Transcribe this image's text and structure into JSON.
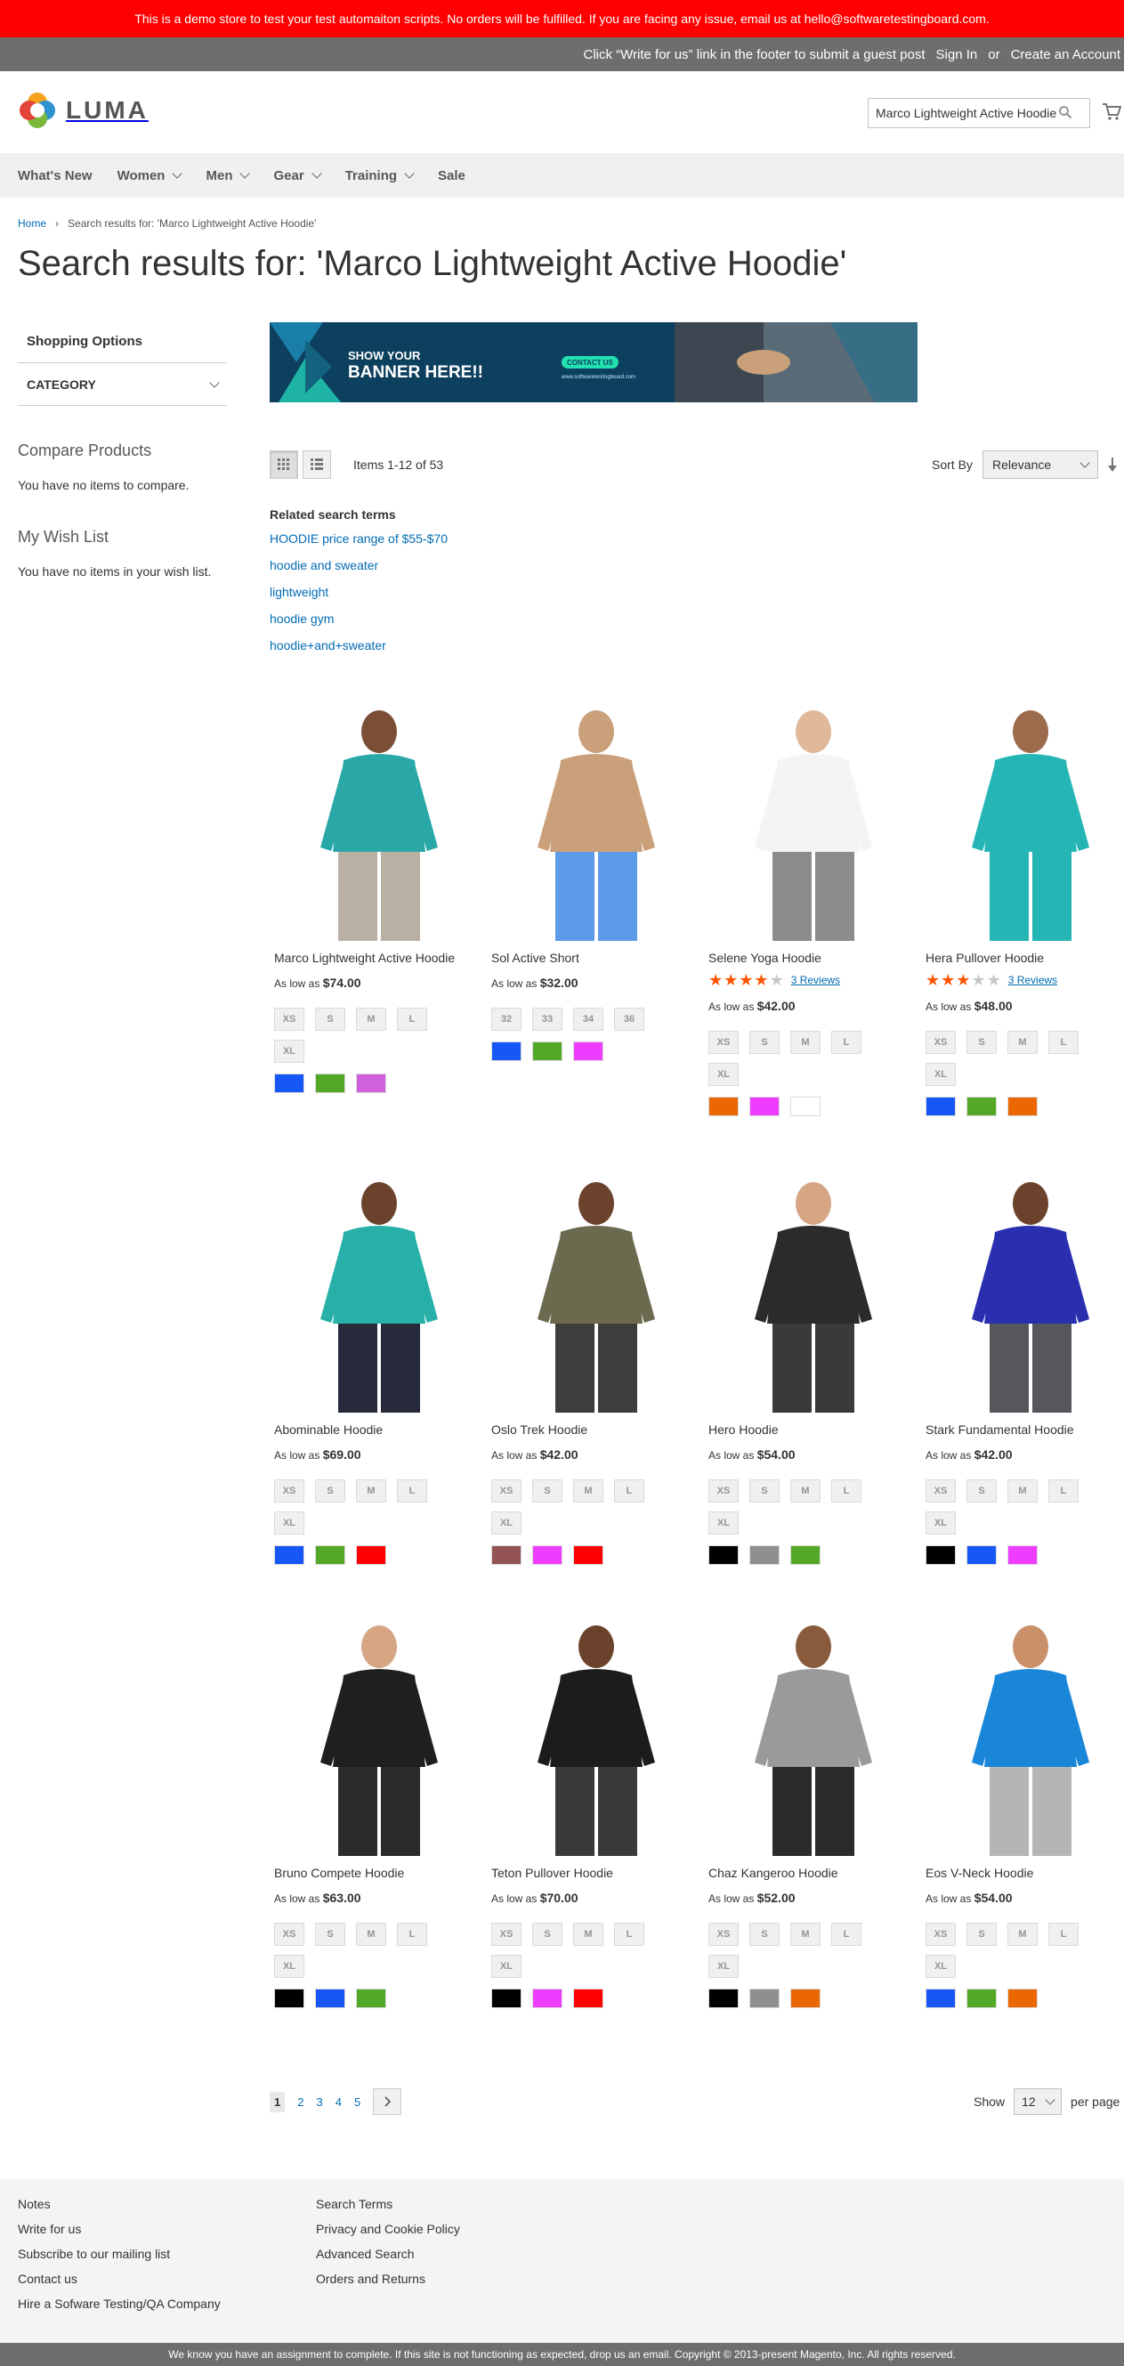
{
  "demo_notice": "This is a demo store to test your test automaiton scripts. No orders will be fulfilled. If you are facing any issue, email us at hello@softwaretestingboard.com.",
  "panel": {
    "guest_post": "Click “Write for us” link in the footer to submit a guest post",
    "sign_in": "Sign In",
    "or": "or",
    "create_account": "Create an Account"
  },
  "header": {
    "logo": "LUMA",
    "search_value": "Marco Lightweight Active Hoodie"
  },
  "nav": {
    "whats_new": "What's New",
    "women": "Women",
    "men": "Men",
    "gear": "Gear",
    "training": "Training",
    "sale": "Sale"
  },
  "breadcrumb": {
    "home": "Home",
    "sep": "›",
    "current": "Search results for: 'Marco Lightweight Active Hoodie'"
  },
  "page_title": "Search results for: 'Marco Lightweight Active Hoodie'",
  "sidebar": {
    "shopping_options": "Shopping Options",
    "category": "Category",
    "compare_title": "Compare Products",
    "compare_text": "You have no items to compare.",
    "wishlist_title": "My Wish List",
    "wishlist_text": "You have no items in your wish list."
  },
  "banner": {
    "line1": "SHOW YOUR",
    "line2": "BANNER HERE!!",
    "cta": "CONTACT US",
    "url": "www.softwaretestingboard.com"
  },
  "toolbar": {
    "amount": "Items 1-12 of 53",
    "sort_by": "Sort By",
    "sort_value": "Relevance"
  },
  "related": {
    "title": "Related search terms",
    "terms": [
      "HOODIE price range of $55-$70",
      "hoodie and sweater",
      "lightweight",
      "hoodie gym",
      "hoodie+and+sweater"
    ]
  },
  "price_prefix": "As low as",
  "products": [
    {
      "name": "Marco Lightweight Active Hoodie",
      "price": "$74.00",
      "sizes": [
        "XS",
        "S",
        "M",
        "L",
        "XL"
      ],
      "colors": [
        "#1857f7",
        "#53a828",
        "#d161db"
      ],
      "shirt": "#2aa8a8",
      "pants": "#b9b0a3",
      "skin": "#7a4f36",
      "reviews": "",
      "rating": 0
    },
    {
      "name": "Sol Active Short",
      "price": "$32.00",
      "sizes": [
        "32",
        "33",
        "34",
        "36"
      ],
      "colors": [
        "#1857f7",
        "#53a828",
        "#ef3dff"
      ],
      "shirt": "#c9a07a",
      "pants": "#5b9be8",
      "skin": "#c9a07a",
      "reviews": "",
      "rating": 0
    },
    {
      "name": "Selene Yoga Hoodie",
      "price": "$42.00",
      "sizes": [
        "XS",
        "S",
        "M",
        "L",
        "XL"
      ],
      "colors": [
        "#eb6703",
        "#ef3dff",
        "#ffffff"
      ],
      "shirt": "#f4f4f4",
      "pants": "#8c8c8c",
      "skin": "#e0b89a",
      "reviews": "3 Reviews",
      "rating": 4
    },
    {
      "name": "Hera Pullover Hoodie",
      "price": "$48.00",
      "sizes": [
        "XS",
        "S",
        "M",
        "L",
        "XL"
      ],
      "colors": [
        "#1857f7",
        "#53a828",
        "#eb6703"
      ],
      "shirt": "#25b5b5",
      "pants": "#25b5b5",
      "skin": "#9c6b4c",
      "reviews": "3 Reviews",
      "rating": 3
    },
    {
      "name": "Abominable Hoodie",
      "price": "$69.00",
      "sizes": [
        "XS",
        "S",
        "M",
        "L",
        "XL"
      ],
      "colors": [
        "#1857f7",
        "#53a828",
        "#ff0000"
      ],
      "shirt": "#26b0a8",
      "pants": "#262a3b",
      "skin": "#6b432d",
      "reviews": "",
      "rating": 0
    },
    {
      "name": "Oslo Trek Hoodie",
      "price": "$42.00",
      "sizes": [
        "XS",
        "S",
        "M",
        "L",
        "XL"
      ],
      "colors": [
        "#945454",
        "#ef3dff",
        "#ff0000"
      ],
      "shirt": "#6b6a4f",
      "pants": "#3d3d3d",
      "skin": "#6b432d",
      "reviews": "",
      "rating": 0
    },
    {
      "name": "Hero Hoodie",
      "price": "$54.00",
      "sizes": [
        "XS",
        "S",
        "M",
        "L",
        "XL"
      ],
      "colors": [
        "#000000",
        "#8f8f8f",
        "#53a828"
      ],
      "shirt": "#2b2b2b",
      "pants": "#3a3a3a",
      "skin": "#d6a584",
      "reviews": "",
      "rating": 0
    },
    {
      "name": "Stark Fundamental Hoodie",
      "price": "$42.00",
      "sizes": [
        "XS",
        "S",
        "M",
        "L",
        "XL"
      ],
      "colors": [
        "#000000",
        "#1857f7",
        "#ef3dff"
      ],
      "shirt": "#2a2fb0",
      "pants": "#55575c",
      "skin": "#6b432d",
      "reviews": "",
      "rating": 0
    },
    {
      "name": "Bruno Compete Hoodie",
      "price": "$63.00",
      "sizes": [
        "XS",
        "S",
        "M",
        "L",
        "XL"
      ],
      "colors": [
        "#000000",
        "#1857f7",
        "#53a828"
      ],
      "shirt": "#1f1f1f",
      "pants": "#2b2b2b",
      "skin": "#d6a584",
      "reviews": "",
      "rating": 0
    },
    {
      "name": "Teton Pullover Hoodie",
      "price": "$70.00",
      "sizes": [
        "XS",
        "S",
        "M",
        "L",
        "XL"
      ],
      "colors": [
        "#000000",
        "#ef3dff",
        "#ff0000"
      ],
      "shirt": "#1c1c1c",
      "pants": "#3a3a3a",
      "skin": "#6b432d",
      "reviews": "",
      "rating": 0
    },
    {
      "name": "Chaz Kangeroo Hoodie",
      "price": "$52.00",
      "sizes": [
        "XS",
        "S",
        "M",
        "L",
        "XL"
      ],
      "colors": [
        "#000000",
        "#8f8f8f",
        "#eb6703"
      ],
      "shirt": "#9a9a9a",
      "pants": "#2b2b2b",
      "skin": "#8a5a3c",
      "reviews": "",
      "rating": 0
    },
    {
      "name": "Eos V-Neck Hoodie",
      "price": "$54.00",
      "sizes": [
        "XS",
        "S",
        "M",
        "L",
        "XL"
      ],
      "colors": [
        "#1857f7",
        "#53a828",
        "#eb6703"
      ],
      "shirt": "#1a86d8",
      "pants": "#b5b5b5",
      "skin": "#c9906a",
      "reviews": "",
      "rating": 0
    }
  ],
  "pager": {
    "current": "1",
    "pages": [
      "2",
      "3",
      "4",
      "5"
    ],
    "show": "Show",
    "limit": "12",
    "per_page": "per page"
  },
  "footer": {
    "col1": [
      "Notes",
      "Write for us",
      "Subscribe to our mailing list",
      "Contact us",
      "Hire a Sofware Testing/QA Company"
    ],
    "col2": [
      "Search Terms",
      "Privacy and Cookie Policy",
      "Advanced Search",
      "Orders and Returns"
    ]
  },
  "copyright": "We know you have an assignment to complete. If this site is not functioning as expected, drop us an email. Copyright © 2013-present Magento, Inc. All rights reserved."
}
